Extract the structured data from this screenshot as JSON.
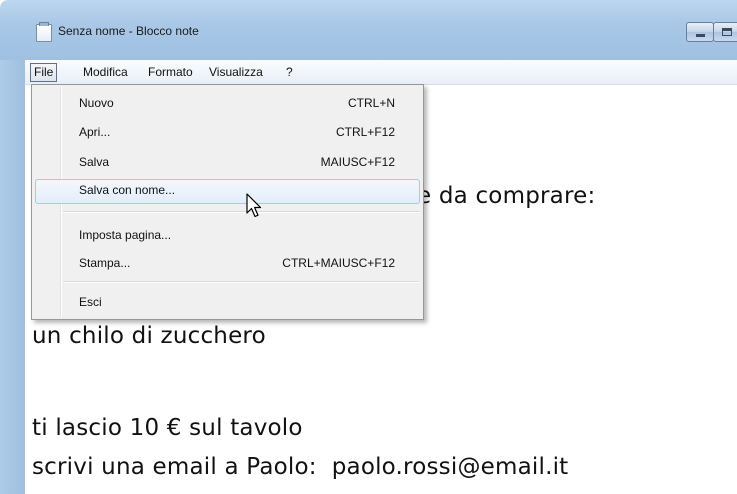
{
  "window": {
    "title": "Senza nome - Blocco note"
  },
  "menubar": {
    "items": [
      {
        "label": "File"
      },
      {
        "label": "Modifica"
      },
      {
        "label": "Formato"
      },
      {
        "label": "Visualizza"
      },
      {
        "label": "?"
      }
    ],
    "active_index": 0
  },
  "file_menu": {
    "items": [
      {
        "label": "Nuovo",
        "shortcut": "CTRL+N"
      },
      {
        "label": "Apri...",
        "shortcut": "CTRL+F12"
      },
      {
        "label": "Salva",
        "shortcut": "MAIUSC+F12"
      },
      {
        "label": "Salva con nome...",
        "shortcut": ""
      },
      {
        "label": "Imposta pagina...",
        "shortcut": ""
      },
      {
        "label": "Stampa...",
        "shortcut": "CTRL+MAIUSC+F12"
      },
      {
        "label": "Esci",
        "shortcut": ""
      }
    ],
    "highlighted_item": "Salva con nome..."
  },
  "document": {
    "lines": [
      "e da comprare:",
      "un chilo di zucchero",
      "ti lascio 10 € sul tavolo",
      "scrivi una email a Paolo:  paolo.rossi@email.it"
    ]
  },
  "icons": {
    "app": "notepad-icon",
    "minimize": "minimize-icon",
    "maximize": "maximize-icon",
    "pointer": "mouse-pointer-icon"
  }
}
